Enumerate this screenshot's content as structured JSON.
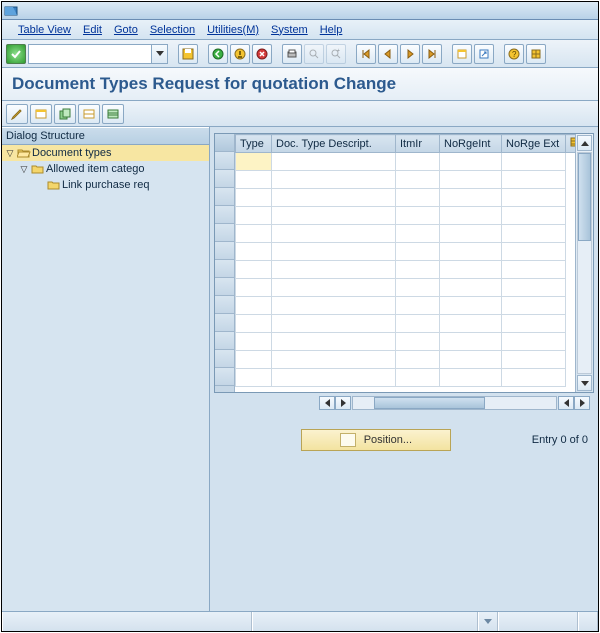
{
  "menu": {
    "table_view": "Table View",
    "edit": "Edit",
    "goto": "Goto",
    "selection": "Selection",
    "utilities": "Utilities(M)",
    "system": "System",
    "help": "Help"
  },
  "page_title": "Document Types Request for quotation Change",
  "tree": {
    "header": "Dialog Structure",
    "n0": "Document types",
    "n1": "Allowed item catego",
    "n2": "Link purchase req"
  },
  "table": {
    "columns": {
      "type": "Type",
      "desc": "Doc. Type Descript.",
      "itmir": "ItmIr",
      "norgeint": "NoRgeInt",
      "norgeext": "NoRge Ext"
    }
  },
  "footer": {
    "position": "Position...",
    "entry": "Entry 0 of 0"
  },
  "icons": {
    "check": "✓",
    "save": "save-icon",
    "back": "back-icon"
  }
}
